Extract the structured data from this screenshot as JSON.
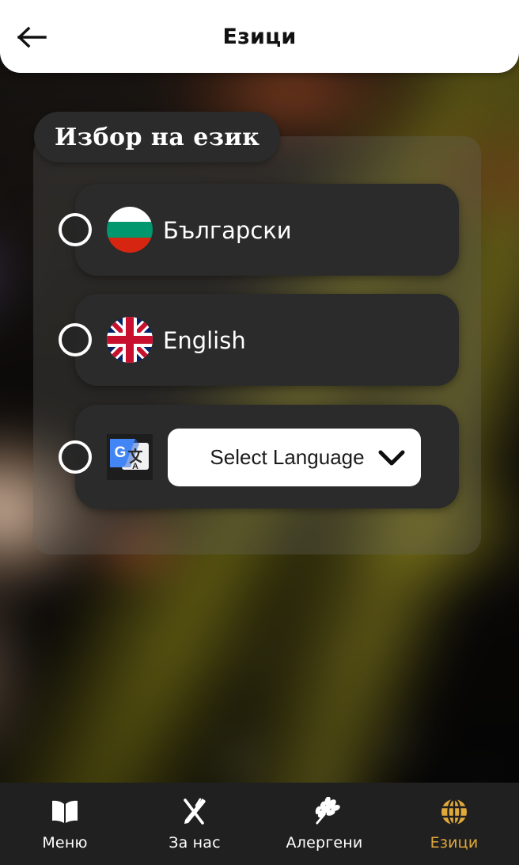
{
  "header": {
    "title": "Езици",
    "back_icon": "arrow-left-icon"
  },
  "section": {
    "title": "Избор на език"
  },
  "options": [
    {
      "id": "bulgarian",
      "label": "Български",
      "flag_icon": "bulgaria-flag-icon",
      "selected": false
    },
    {
      "id": "english",
      "label": "English",
      "flag_icon": "uk-flag-icon",
      "selected": false
    },
    {
      "id": "google-translate",
      "label": "",
      "flag_icon": "google-translate-icon",
      "selected": false
    }
  ],
  "dropdown": {
    "value": "Select Language",
    "chevron_icon": "chevron-down-icon"
  },
  "bottom_nav": {
    "items": [
      {
        "label": "Меню",
        "icon": "book-icon",
        "active": false
      },
      {
        "label": "За нас",
        "icon": "cutlery-icon",
        "active": false
      },
      {
        "label": "Алергени",
        "icon": "wheat-icon",
        "active": false
      },
      {
        "label": "Езици",
        "icon": "globe-icon",
        "active": true
      }
    ]
  },
  "colors": {
    "accent": "#E0A93B",
    "card": "#2b2b2b",
    "nav_bar": "#202020",
    "header_bg": "#ffffff",
    "bulgaria_green": "#00966E",
    "bulgaria_red": "#D62612",
    "uk_blue": "#012169",
    "uk_red": "#C8102E"
  }
}
